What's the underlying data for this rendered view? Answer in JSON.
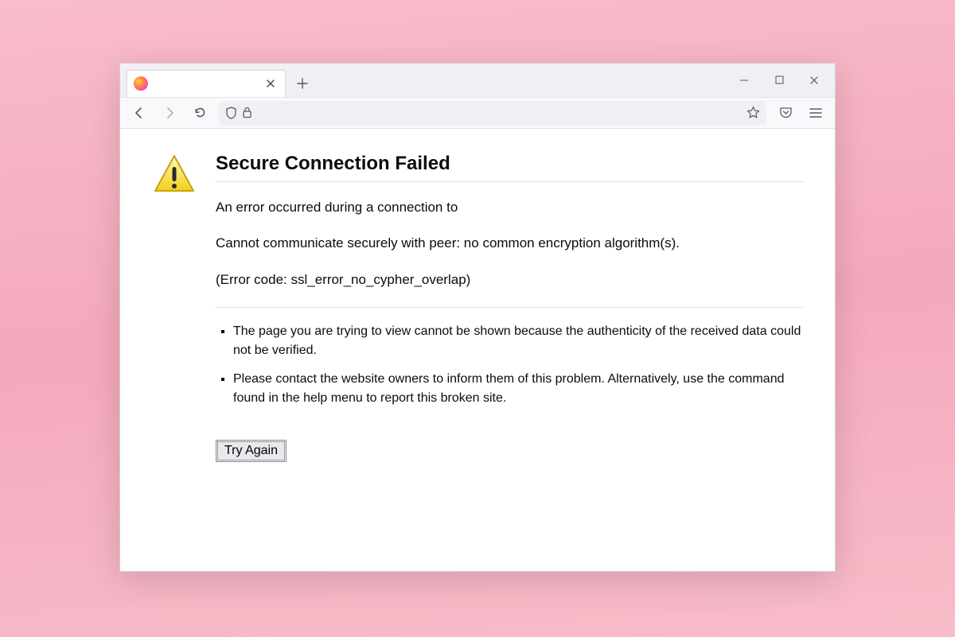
{
  "tab": {
    "title": ""
  },
  "error": {
    "heading": "Secure Connection Failed",
    "line1": "An error occurred during a connection to",
    "line2": "Cannot communicate securely with peer: no common encryption algorithm(s).",
    "line3": "(Error code: ssl_error_no_cypher_overlap)",
    "bullets": [
      "The page you are trying to view cannot be shown because the authenticity of the received data could not be verified.",
      "Please contact the website owners to inform them of this problem. Alternatively, use the command found in the help menu to report this broken site."
    ],
    "try_again": "Try Again"
  }
}
